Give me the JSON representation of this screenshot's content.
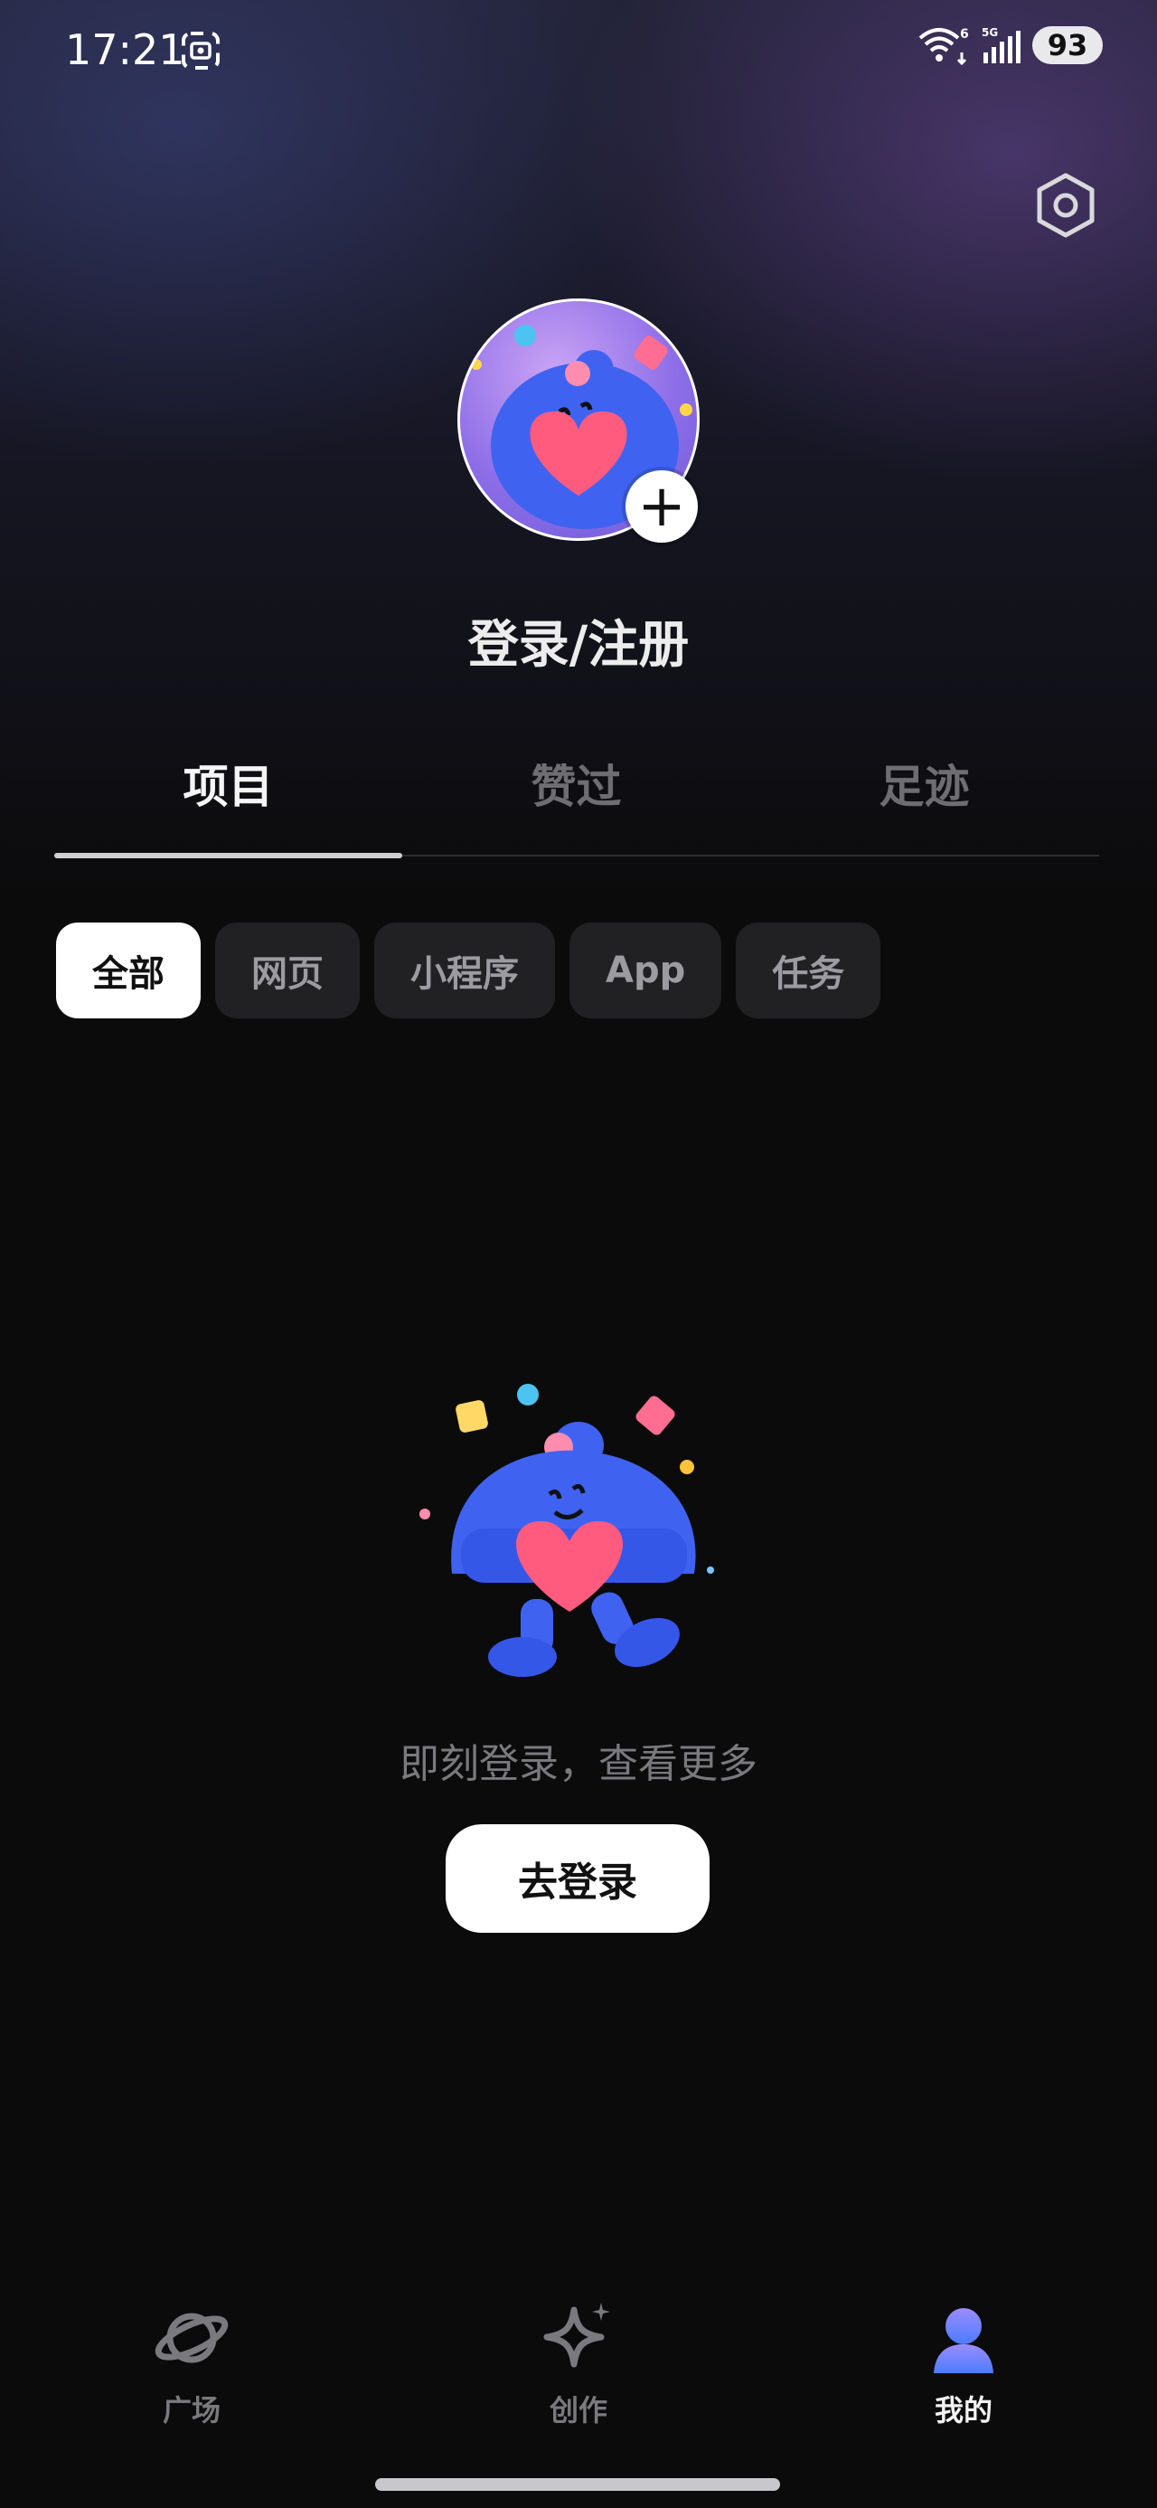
{
  "status_bar": {
    "time": "17:21",
    "wifi_badge": "6",
    "network": "5G",
    "battery": "93",
    "icons": [
      "screen-record-icon",
      "wifi-icon",
      "signal-icon"
    ]
  },
  "header": {
    "settings_icon": "settings-hexagon-icon",
    "add_avatar_icon": "plus-icon",
    "login_title": "登录/注册"
  },
  "tabs": [
    {
      "label": "项目",
      "active": true
    },
    {
      "label": "赞过",
      "active": false
    },
    {
      "label": "足迹",
      "active": false
    }
  ],
  "filters": [
    {
      "label": "全部",
      "active": true
    },
    {
      "label": "网页",
      "active": false
    },
    {
      "label": "小程序",
      "active": false
    },
    {
      "label": "App",
      "active": false
    },
    {
      "label": "任务",
      "active": false
    }
  ],
  "empty_state": {
    "message": "即刻登录，查看更多",
    "button_label": "去登录"
  },
  "bottom_nav": [
    {
      "label": "广场",
      "icon": "planet-icon",
      "active": false
    },
    {
      "label": "创作",
      "icon": "sparkle-icon",
      "active": false
    },
    {
      "label": "我的",
      "icon": "profile-avatar-icon",
      "active": true
    }
  ],
  "colors": {
    "background": "#0b0b0c",
    "chip_active": "#ffffff",
    "chip_inactive": "#212124",
    "text_muted": "#7a7a7e"
  }
}
